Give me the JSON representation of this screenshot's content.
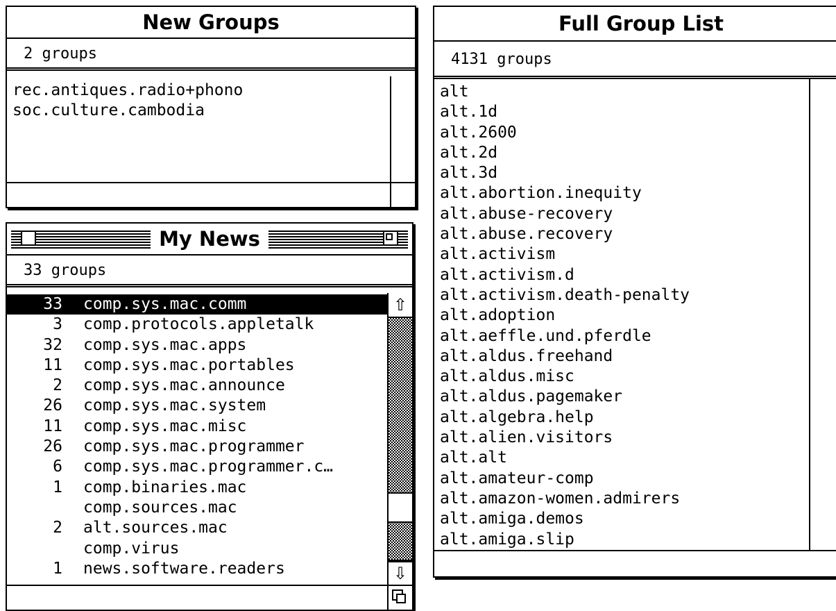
{
  "new_groups": {
    "title": "New Groups",
    "count_label": "2 groups",
    "items": [
      "rec.antiques.radio+phono",
      "soc.culture.cambodia"
    ]
  },
  "my_news": {
    "title": "My News",
    "count_label": "33 groups",
    "rows": [
      {
        "count": "33",
        "name": "comp.sys.mac.comm"
      },
      {
        "count": "3",
        "name": "comp.protocols.appletalk"
      },
      {
        "count": "32",
        "name": "comp.sys.mac.apps"
      },
      {
        "count": "11",
        "name": "comp.sys.mac.portables"
      },
      {
        "count": "2",
        "name": "comp.sys.mac.announce"
      },
      {
        "count": "26",
        "name": "comp.sys.mac.system"
      },
      {
        "count": "11",
        "name": "comp.sys.mac.misc"
      },
      {
        "count": "26",
        "name": "comp.sys.mac.programmer"
      },
      {
        "count": "6",
        "name": "comp.sys.mac.programmer.c…"
      },
      {
        "count": "1",
        "name": "comp.binaries.mac"
      },
      {
        "count": "",
        "name": "comp.sources.mac"
      },
      {
        "count": "2",
        "name": "alt.sources.mac"
      },
      {
        "count": "",
        "name": "comp.virus"
      },
      {
        "count": "1",
        "name": "news.software.readers"
      }
    ],
    "selected_index": 0,
    "scroll_position": 0.82
  },
  "full_group_list": {
    "title": "Full Group List",
    "count_label": "4131 groups",
    "items": [
      "alt",
      "alt.1d",
      "alt.2600",
      "alt.2d",
      "alt.3d",
      "alt.abortion.inequity",
      "alt.abuse-recovery",
      "alt.abuse.recovery",
      "alt.activism",
      "alt.activism.d",
      "alt.activism.death-penalty",
      "alt.adoption",
      "alt.aeffle.und.pferdle",
      "alt.aldus.freehand",
      "alt.aldus.misc",
      "alt.aldus.pagemaker",
      "alt.algebra.help",
      "alt.alien.visitors",
      "alt.alt",
      "alt.amateur-comp",
      "alt.amazon-women.admirers",
      "alt.amiga.demos",
      "alt.amiga.slip"
    ]
  },
  "icons": {
    "up_arrow": "⇧",
    "down_arrow": "⇩",
    "grow_box": "grow-box-icon",
    "close_box": "close-box-icon",
    "zoom_box": "zoom-box-icon"
  }
}
